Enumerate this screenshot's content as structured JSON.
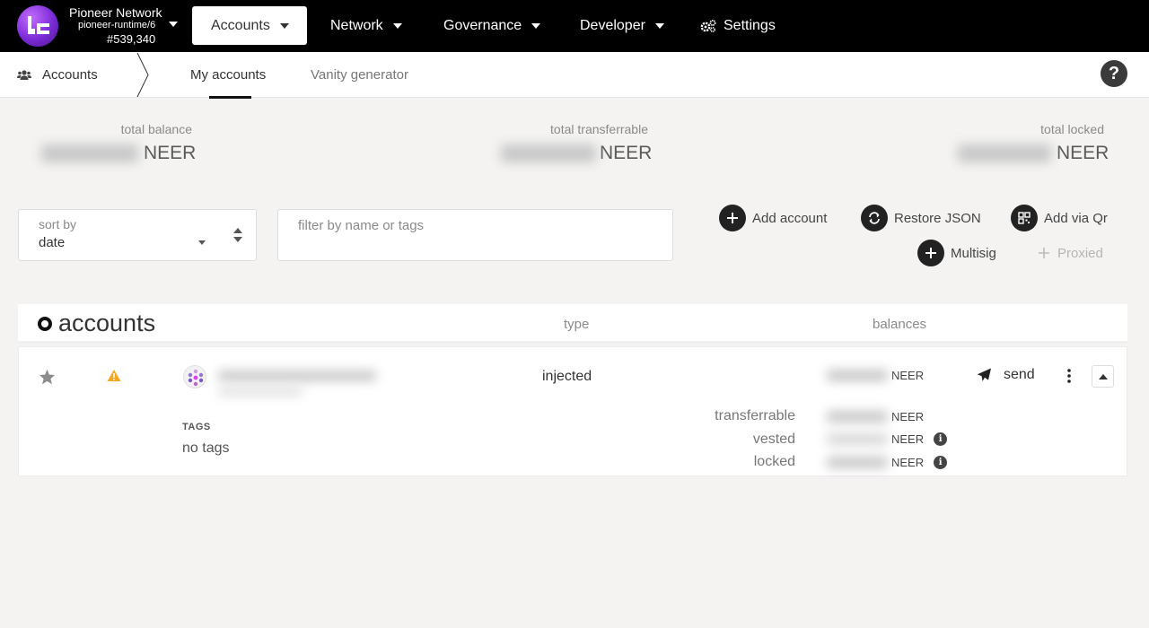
{
  "header": {
    "chain_name": "Pioneer Network",
    "runtime": "pioneer-runtime/6",
    "block": "#539,340",
    "nav": [
      {
        "label": "Accounts"
      },
      {
        "label": "Network"
      },
      {
        "label": "Governance"
      },
      {
        "label": "Developer"
      },
      {
        "label": "Settings"
      }
    ]
  },
  "subnav": {
    "section": "Accounts",
    "tabs": [
      {
        "label": "My accounts",
        "active": true
      },
      {
        "label": "Vanity generator",
        "active": false
      }
    ],
    "help": "?"
  },
  "summary": {
    "total_balance_label": "total balance",
    "total_transferrable_label": "total transferrable",
    "total_locked_label": "total locked",
    "unit": "NEER"
  },
  "controls": {
    "sort_label": "sort by",
    "sort_value": "date",
    "filter_placeholder": "filter by name or tags",
    "actions": {
      "add_account": "Add account",
      "restore_json": "Restore JSON",
      "add_via_qr": "Add via Qr",
      "multisig": "Multisig",
      "proxied": "Proxied"
    }
  },
  "table": {
    "title": "accounts",
    "col_type": "type",
    "col_balances": "balances",
    "rows": [
      {
        "type": "injected",
        "unit": "NEER",
        "send_label": "send",
        "tags_label": "TAGS",
        "tags_value": "no tags",
        "breakdown": [
          {
            "label": "transferrable",
            "unit": "NEER"
          },
          {
            "label": "vested",
            "unit": "NEER"
          },
          {
            "label": "locked",
            "unit": "NEER"
          }
        ]
      }
    ]
  },
  "colors": {
    "topbar": "#000000",
    "background": "#f4f3f2",
    "warning": "#f5a623",
    "accent": "#222222"
  }
}
